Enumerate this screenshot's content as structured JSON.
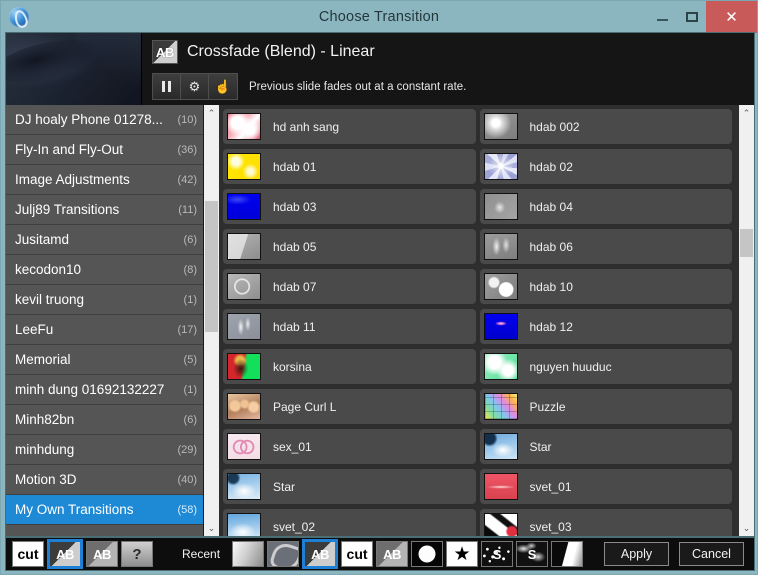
{
  "window": {
    "title": "Choose Transition",
    "app_icon": "app-orb-icon",
    "minimize_label": "–",
    "maximize_label": "",
    "close_label": "✕"
  },
  "header": {
    "preview_name": "transition-preview",
    "icon": "AB",
    "transition_name": "Crossfade (Blend) - Linear",
    "description": "Previous slide fades out at a constant rate.",
    "controls": [
      {
        "name": "pause-button",
        "glyph": "pause"
      },
      {
        "name": "settings-gear-button",
        "glyph": "⚙"
      },
      {
        "name": "hand-pointer-button",
        "glyph": "☝"
      }
    ]
  },
  "categories": {
    "selected": "My Own Transitions",
    "items": [
      {
        "label": "DJ hoaly Phone 01278...",
        "count": "(10)",
        "selected": false
      },
      {
        "label": "Fly-In and Fly-Out",
        "count": "(36)",
        "selected": false
      },
      {
        "label": "Image Adjustments",
        "count": "(42)",
        "selected": false
      },
      {
        "label": "Julj89 Transitions",
        "count": "(11)",
        "selected": false
      },
      {
        "label": "Jusitamd",
        "count": "(6)",
        "selected": false
      },
      {
        "label": "kecodon10",
        "count": "(8)",
        "selected": false
      },
      {
        "label": "kevil truong",
        "count": "(1)",
        "selected": false
      },
      {
        "label": "LeeFu",
        "count": "(17)",
        "selected": false
      },
      {
        "label": "Memorial",
        "count": "(5)",
        "selected": false
      },
      {
        "label": "minh dung 01692132227",
        "count": "(1)",
        "selected": false
      },
      {
        "label": "Minh82bn",
        "count": "(6)",
        "selected": false
      },
      {
        "label": "minhdung",
        "count": "(29)",
        "selected": false
      },
      {
        "label": "Motion 3D",
        "count": "(40)",
        "selected": false
      },
      {
        "label": "My Own Transitions",
        "count": "(58)",
        "selected": true
      },
      {
        "label": "",
        "count": "",
        "selected": false
      }
    ],
    "scrollbar": {
      "up": "⌃",
      "down": "⌄",
      "thumb_top_pct": 20,
      "thumb_height_pct": 33
    }
  },
  "transitions": {
    "items": [
      {
        "label": "hd anh sang",
        "thumb": "red-white-burst"
      },
      {
        "label": "hdab 002",
        "thumb": "grey-glow"
      },
      {
        "label": "hdab 01",
        "thumb": "yellow-sparkle"
      },
      {
        "label": "hdab 02",
        "thumb": "lavender-starburst"
      },
      {
        "label": "hdab 03",
        "thumb": "blue-solid"
      },
      {
        "label": "hdab 04",
        "thumb": "grey-smoke"
      },
      {
        "label": "hdab 05",
        "thumb": "grey-lines"
      },
      {
        "label": "hdab 06",
        "thumb": "grey-swirl"
      },
      {
        "label": "hdab 07",
        "thumb": "grey-circle-sketch"
      },
      {
        "label": "hdab 10",
        "thumb": "grey-stars"
      },
      {
        "label": "hdab 11",
        "thumb": "grey-ribbon"
      },
      {
        "label": "hdab 12",
        "thumb": "blue-streak"
      },
      {
        "label": "korsina",
        "thumb": "red-green-figure"
      },
      {
        "label": "nguyen huuduc",
        "thumb": "green-white-mottle"
      },
      {
        "label": "Page Curl L",
        "thumb": "photo-people"
      },
      {
        "label": "Puzzle",
        "thumb": "colorful-puzzle"
      },
      {
        "label": "sex_01",
        "thumb": "pink-rings"
      },
      {
        "label": "Star",
        "thumb": "blue-sky-clouds"
      },
      {
        "label": "Star",
        "thumb": "blue-sky-clouds-2"
      },
      {
        "label": "svet_01",
        "thumb": "red-flare"
      },
      {
        "label": "svet_02",
        "thumb": "blue-sky-light"
      },
      {
        "label": "svet_03",
        "thumb": "black-white-splash"
      }
    ],
    "scrollbar": {
      "up": "⌃",
      "down": "⌄",
      "thumb_top_pct": 27,
      "thumb_height_pct": 7
    }
  },
  "toolbar": {
    "type_buttons": [
      {
        "name": "toolbar-cut-button",
        "kind": "cut",
        "text": "cut",
        "selected": false
      },
      {
        "name": "toolbar-crossfade-button",
        "kind": "ab-dark",
        "text": "AB",
        "selected": true
      },
      {
        "name": "toolbar-fade-button",
        "kind": "ab-light",
        "text": "AB",
        "selected": false
      },
      {
        "name": "toolbar-help-button",
        "kind": "question",
        "text": "?",
        "selected": false
      }
    ],
    "recent_label": "Recent",
    "recent_buttons": [
      {
        "name": "recent-gradient-button",
        "kind": "grad",
        "text": "",
        "selected": false
      },
      {
        "name": "recent-swirl-button",
        "kind": "swirl",
        "text": "",
        "selected": false
      },
      {
        "name": "recent-crossfade-button",
        "kind": "ab-dark",
        "text": "AB",
        "selected": true
      },
      {
        "name": "recent-cut-button",
        "kind": "cut",
        "text": "cut",
        "selected": false
      },
      {
        "name": "recent-fade-button",
        "kind": "ab-light",
        "text": "AB",
        "selected": false
      },
      {
        "name": "recent-circle-button",
        "kind": "circle",
        "text": "",
        "selected": false
      },
      {
        "name": "recent-star-button",
        "kind": "star",
        "text": "★",
        "selected": false
      },
      {
        "name": "recent-noise-s-button",
        "kind": "noise1",
        "text": "S",
        "selected": false
      },
      {
        "name": "recent-blob-s-button",
        "kind": "noise2",
        "text": "S",
        "selected": false
      },
      {
        "name": "recent-wipe-button",
        "kind": "half",
        "text": "",
        "selected": false
      }
    ],
    "apply_label": "Apply",
    "cancel_label": "Cancel"
  },
  "colors": {
    "titlebar": "#8cb6bf",
    "close_button": "#c85a5a",
    "selection_blue": "#1e8ad6",
    "panel_dark": "#2e2e2e",
    "category_bg": "#555555",
    "item_bg": "#4a4a4a"
  }
}
